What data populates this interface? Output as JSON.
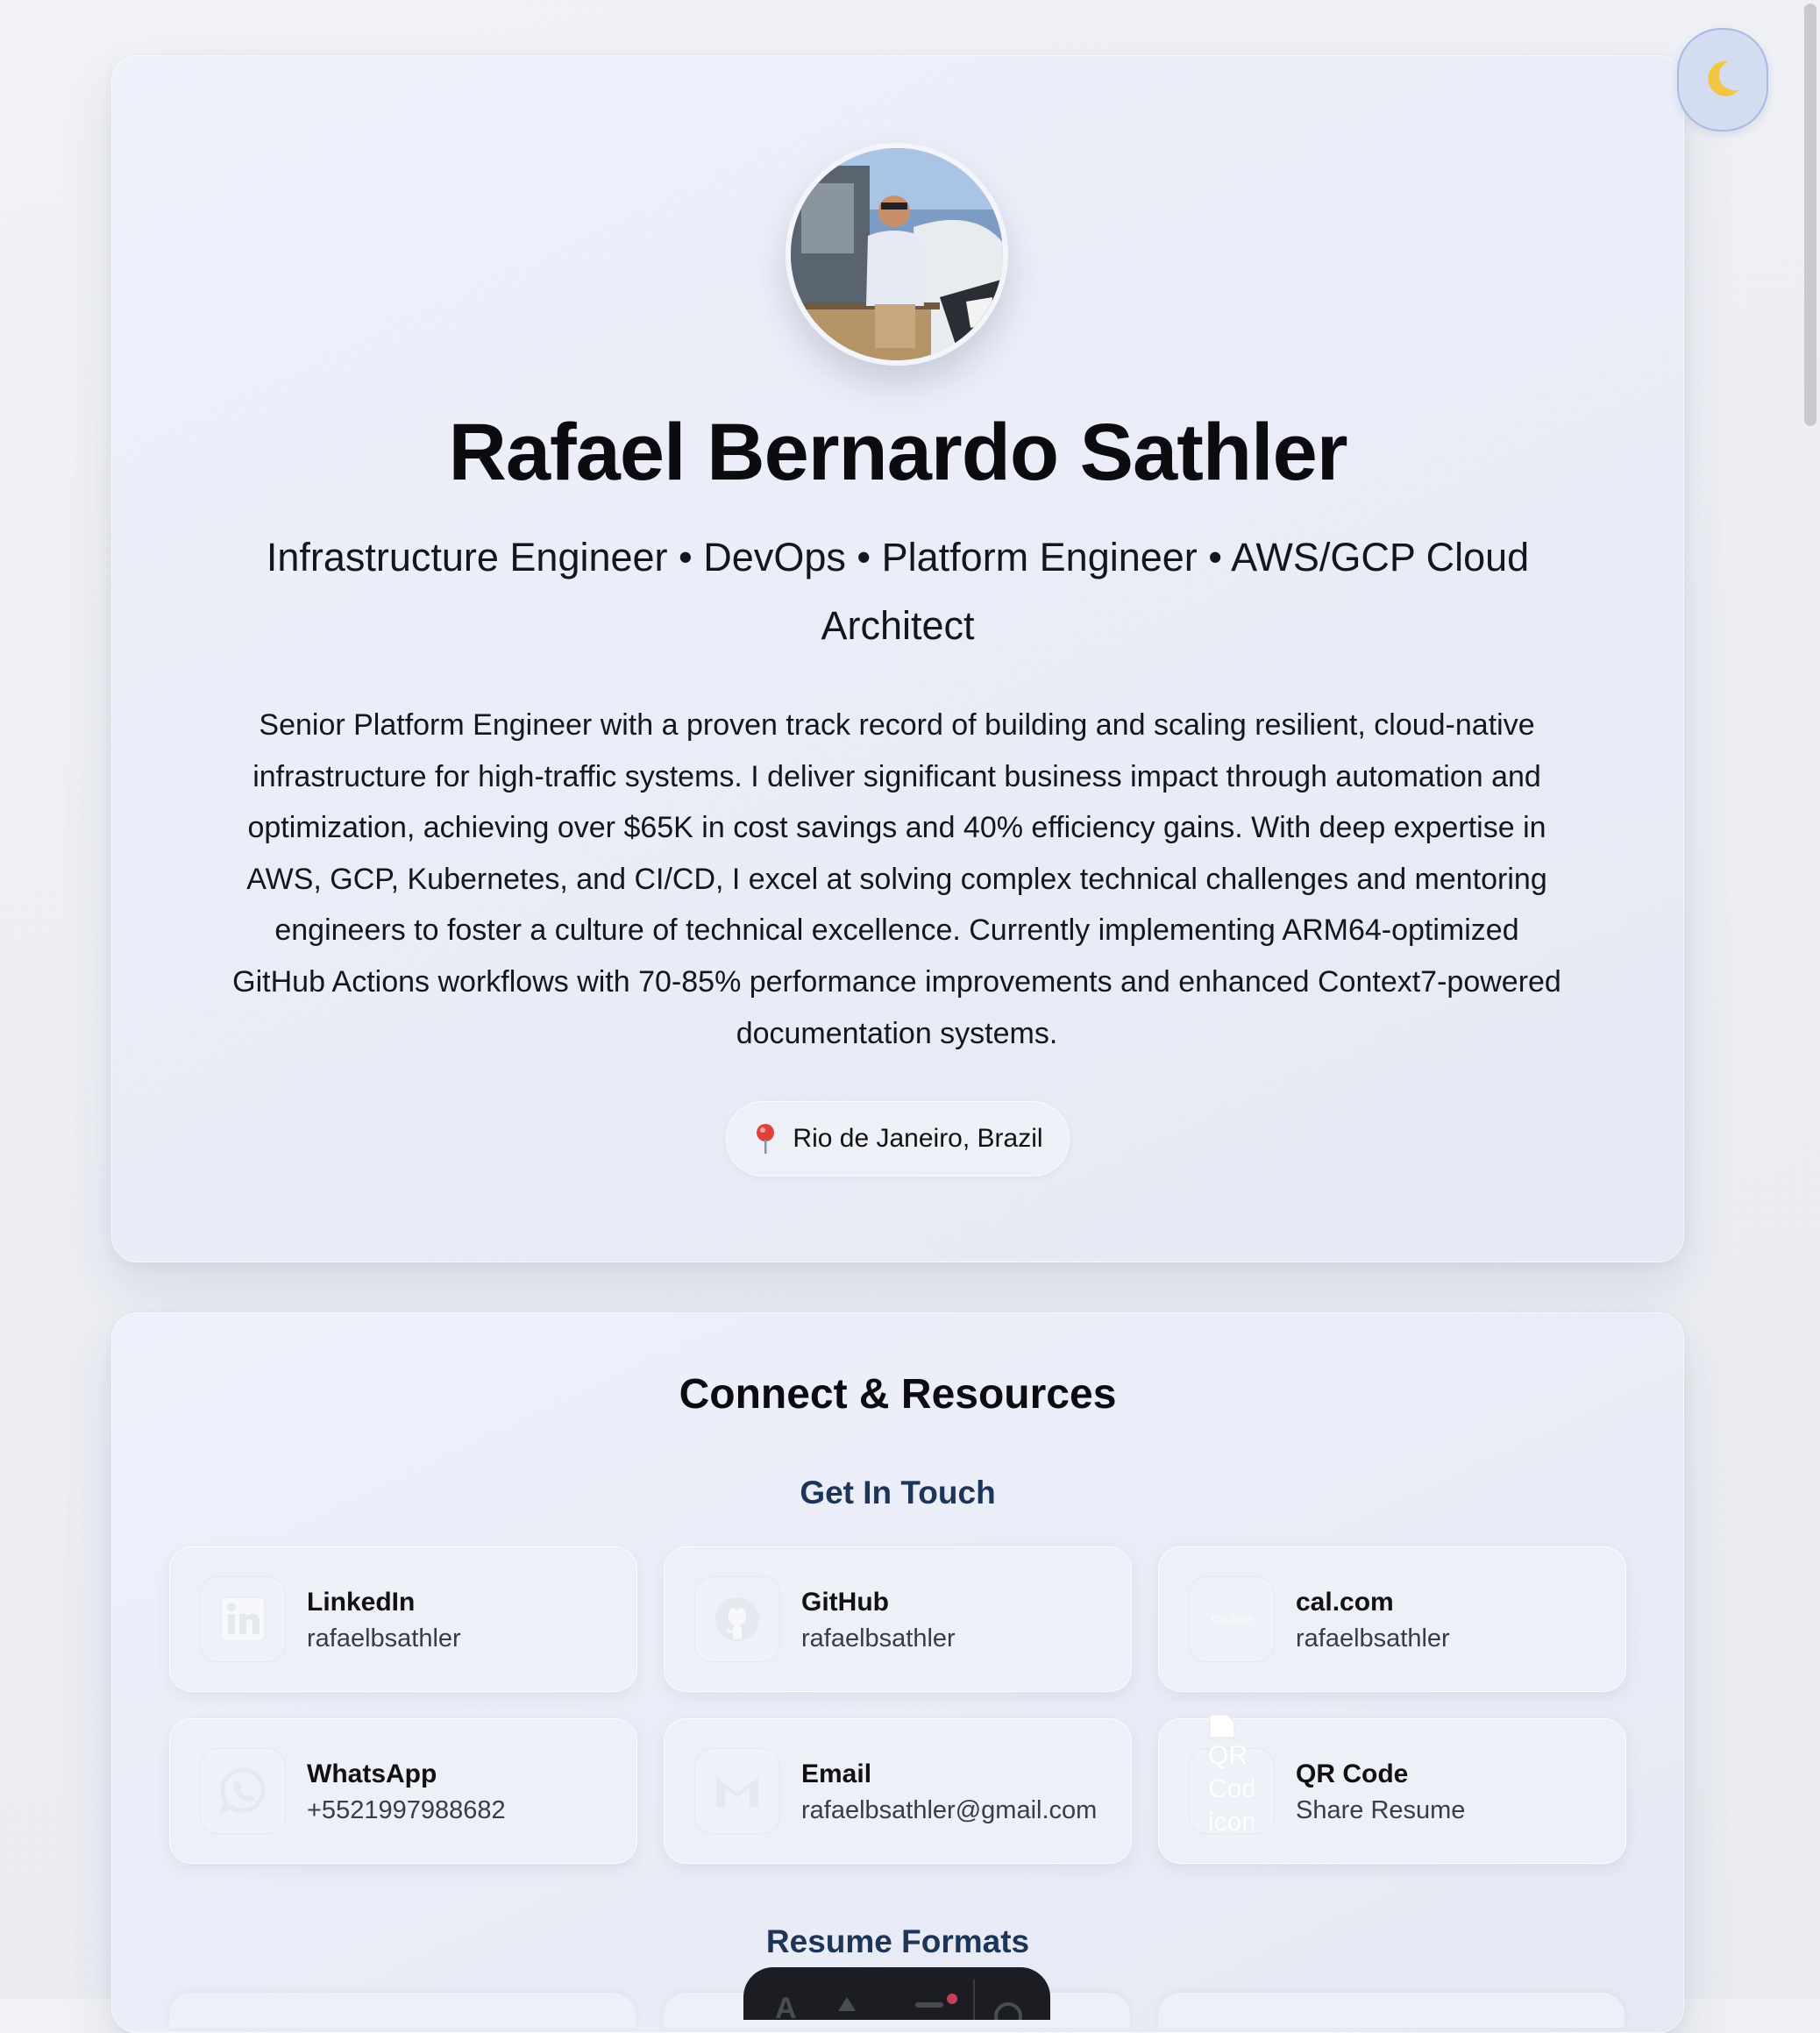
{
  "profile": {
    "name": "Rafael Bernardo Sathler",
    "subtitle": "Infrastructure Engineer • DevOps • Platform Engineer • AWS/GCP Cloud Architect",
    "bio": "Senior Platform Engineer with a proven track record of building and scaling resilient, cloud-native infrastructure for high-traffic systems. I deliver significant business impact through automation and optimization, achieving over $65K in cost savings and 40% efficiency gains. With deep expertise in AWS, GCP, Kubernetes, and CI/CD, I excel at solving complex technical challenges and mentoring engineers to foster a culture of technical excellence. Currently implementing ARM64-optimized GitHub Actions workflows with 70-85% performance improvements and enhanced Context7-powered documentation systems.",
    "location": "Rio de Janeiro, Brazil",
    "avatar_icon": "profile-photo"
  },
  "theme_toggle": {
    "icon": "moon-icon"
  },
  "connect": {
    "title": "Connect & Resources",
    "get_in_touch": "Get In Touch",
    "resume_formats": "Resume Formats",
    "tiles": [
      {
        "label": "LinkedIn",
        "value": "rafaelbsathler",
        "icon": "linkedin-icon"
      },
      {
        "label": "GitHub",
        "value": "rafaelbsathler",
        "icon": "github-icon"
      },
      {
        "label": "cal.com",
        "value": "rafaelbsathler",
        "icon": "calcom-icon",
        "icon_text": "Cal.com"
      },
      {
        "label": "WhatsApp",
        "value": "+5521997988682",
        "icon": "whatsapp-icon"
      },
      {
        "label": "Email",
        "value": "rafaelbsathler@gmail.com",
        "icon": "gmail-icon"
      },
      {
        "label": "QR Code",
        "value": "Share Resume",
        "icon": "qr-code-icon",
        "broken_alt": "QR Code icon"
      }
    ]
  },
  "colors": {
    "accent_heading": "#1e3558",
    "theme_button_bg": "#d4dcf1",
    "pin": "#e0413a"
  }
}
